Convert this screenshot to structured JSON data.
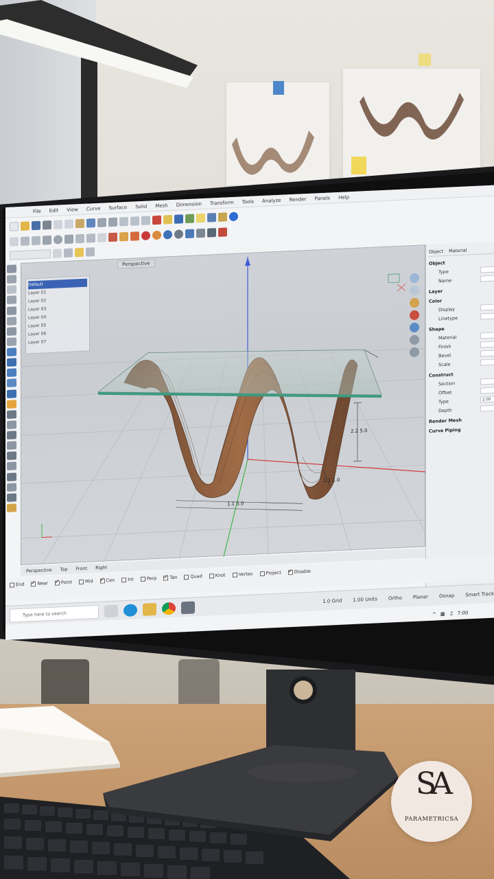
{
  "brand": {
    "name": "PARAMETRICSA",
    "monogram": "SA"
  },
  "screen": {
    "menu": [
      "File",
      "Edit",
      "View",
      "Curve",
      "Surface",
      "Solid",
      "Mesh",
      "Dimension",
      "Transform",
      "Tools",
      "Analyze",
      "Render",
      "Panels",
      "Help"
    ],
    "viewport_tab": "Perspective",
    "viewport_tabs": [
      "Perspective",
      "Top",
      "Front",
      "Right"
    ],
    "layers": [
      "Default",
      "Layer 01",
      "Layer 02",
      "Layer 03",
      "Layer 04",
      "Layer 05",
      "Layer 06",
      "Layer 07"
    ],
    "dimensions": [
      "2.2 5.0",
      "1.1 5.0",
      "1.1 1.0"
    ],
    "properties": {
      "tabs": [
        "Object",
        "Material"
      ],
      "sections": [
        {
          "title": "Object",
          "rows": [
            {
              "label": "Type",
              "value": ""
            },
            {
              "label": "Name",
              "value": ""
            }
          ]
        },
        {
          "title": "Layer",
          "rows": []
        },
        {
          "title": "Color",
          "rows": [
            {
              "label": "Display",
              "value": ""
            },
            {
              "label": "Linetype",
              "value": ""
            }
          ]
        },
        {
          "title": "Shape",
          "rows": [
            {
              "label": "Material",
              "value": ""
            },
            {
              "label": "Finish",
              "value": ""
            },
            {
              "label": "Bevel",
              "value": ""
            },
            {
              "label": "Scale",
              "value": ""
            }
          ]
        },
        {
          "title": "Construct",
          "rows": [
            {
              "label": "Section",
              "value": ""
            },
            {
              "label": "Offset",
              "value": ""
            },
            {
              "label": "Type",
              "value": "2.00"
            },
            {
              "label": "Depth",
              "value": ""
            }
          ]
        }
      ],
      "extra": [
        "Render Mesh",
        "Curve Piping"
      ]
    },
    "osnap_items": [
      "End",
      "Near",
      "Point",
      "Mid",
      "Cen",
      "Int",
      "Perp",
      "Tan",
      "Quad",
      "Knot",
      "Vertex",
      "Project",
      "Disable"
    ],
    "taskbar": {
      "search_placeholder": "Type here to search",
      "status": [
        "1.0 Grid",
        "1.00 Units",
        "Ortho",
        "Planar",
        "Osnap",
        "Smart Track"
      ],
      "clock": "7:00"
    }
  }
}
